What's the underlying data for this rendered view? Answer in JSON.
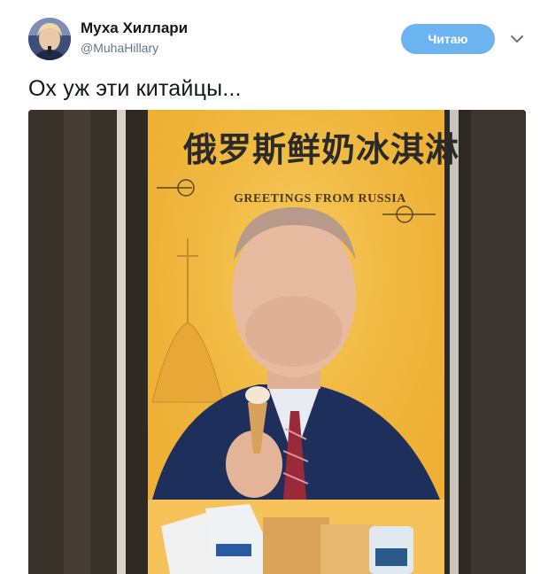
{
  "author": {
    "name": "Муха Хиллари",
    "handle": "@MuhaHillary"
  },
  "follow_button": {
    "label": "Читаю"
  },
  "tweet": {
    "text": "Ох уж эти китайцы..."
  },
  "poster": {
    "chinese_title": "俄罗斯鲜奶冰淇淋",
    "greeting": "GREETINGS FROM RUSSIA"
  },
  "icons": {
    "menu": "chevron-down-icon"
  },
  "colors": {
    "follow_button": "#6cb4f0",
    "poster_yellow": "#f2b73a"
  }
}
